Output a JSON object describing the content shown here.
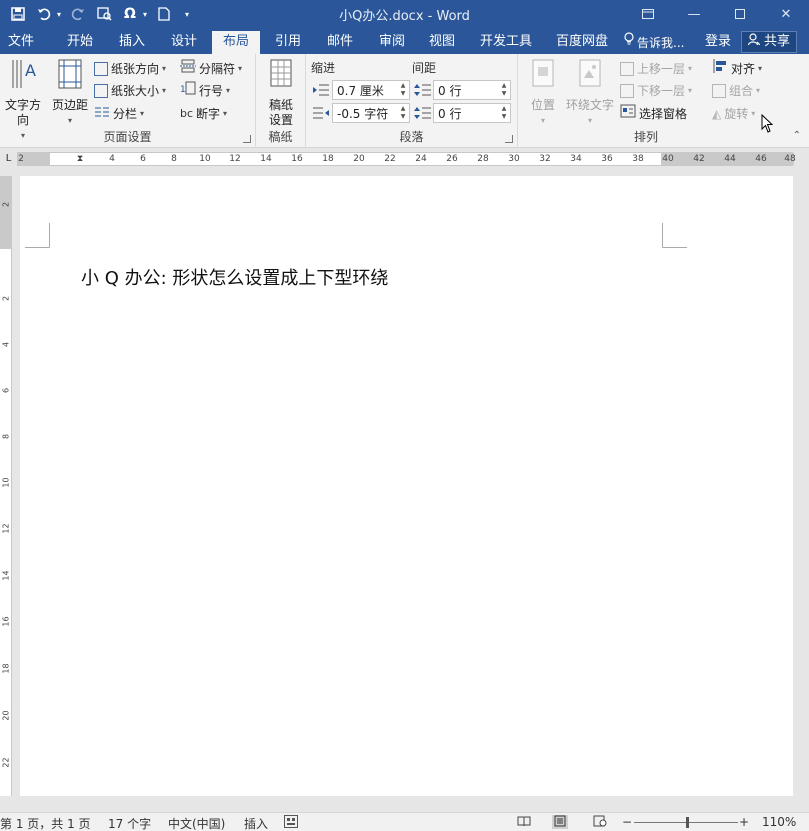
{
  "titlebar": {
    "title": "小Q办公.docx - Word",
    "icons": [
      "save-icon",
      "undo-icon",
      "redo-icon",
      "print-preview-icon",
      "symbol-omega-icon",
      "new-document-icon",
      "customize-qat-icon"
    ]
  },
  "menu": {
    "tabs": [
      "文件",
      "开始",
      "插入",
      "设计",
      "布局",
      "引用",
      "邮件",
      "审阅",
      "视图",
      "开发工具",
      "百度网盘"
    ],
    "active": "布局",
    "tell_me": "告诉我...",
    "login": "登录",
    "share": "共享"
  },
  "ribbon": {
    "page_setup": {
      "label": "页面设置",
      "text_direction": "文字方向",
      "margins": "页边距",
      "orientation": "纸张方向",
      "size": "纸张大小",
      "columns": "分栏",
      "breaks": "分隔符",
      "line_numbers": "行号",
      "hyphenation": "断字"
    },
    "manuscript": {
      "label": "稿纸",
      "settings": "稿纸\n设置"
    },
    "paragraph": {
      "label": "段落",
      "indent_label": "缩进",
      "spacing_label": "间距",
      "indent_left": "0.7 厘米",
      "indent_right": "-0.5 字符",
      "spacing_before": "0 行",
      "spacing_after": "0 行"
    },
    "arrange": {
      "label": "排列",
      "position": "位置",
      "wrap_text": "环绕文字",
      "bring_forward": "上移一层",
      "send_backward": "下移一层",
      "selection_pane": "选择窗格",
      "align": "对齐",
      "group": "组合",
      "rotate": "旋转"
    }
  },
  "ruler": {
    "corner": "L",
    "h_numbers": [
      "2",
      "2",
      "4",
      "6",
      "8",
      "10",
      "12",
      "14",
      "16",
      "18",
      "20",
      "22",
      "24",
      "26",
      "28",
      "30",
      "32",
      "34",
      "36",
      "38",
      "40",
      "42",
      "44",
      "46",
      "48"
    ],
    "v_numbers": [
      "2",
      "2",
      "4",
      "6",
      "8",
      "10",
      "12",
      "14",
      "16",
      "18",
      "20",
      "22"
    ]
  },
  "document": {
    "text": "小 Q 办公:   形状怎么设置成上下型环绕"
  },
  "statusbar": {
    "page": "第 1 页，共 1 页",
    "words": "17 个字",
    "language": "中文(中国)",
    "mode": "插入",
    "zoom": "110%",
    "zoom_minus": "−",
    "zoom_plus": "+"
  }
}
